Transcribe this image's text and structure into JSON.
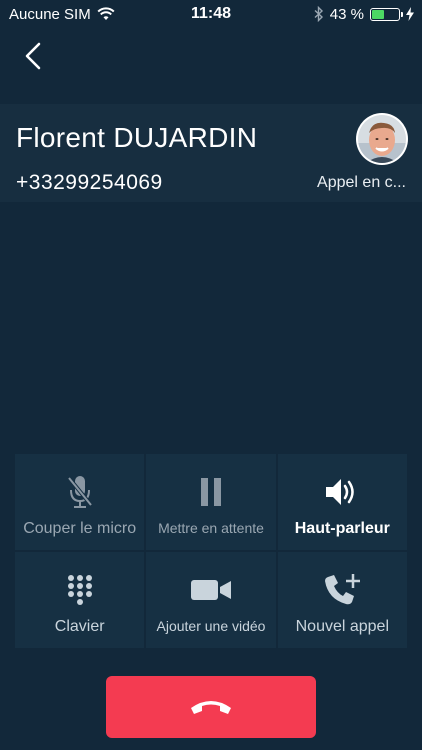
{
  "status_bar": {
    "carrier": "Aucune SIM",
    "time": "11:48",
    "battery_percent": "43 %",
    "battery_level": 0.43
  },
  "caller": {
    "name": "Florent DUJARDIN",
    "number": "+33299254069",
    "status": "Appel en c..."
  },
  "actions": [
    {
      "label": "Couper le micro",
      "icon": "microphone-muted-icon"
    },
    {
      "label": "Mettre en attente",
      "icon": "pause-icon"
    },
    {
      "label": "Haut-parleur",
      "icon": "speaker-icon"
    },
    {
      "label": "Clavier",
      "icon": "keypad-icon"
    },
    {
      "label": "Ajouter une vidéo",
      "icon": "video-camera-icon"
    },
    {
      "label": "Nouvel appel",
      "icon": "add-call-icon"
    }
  ],
  "colors": {
    "background": "#12283a",
    "hangup": "#f43b51",
    "battery": "#4cd964"
  }
}
